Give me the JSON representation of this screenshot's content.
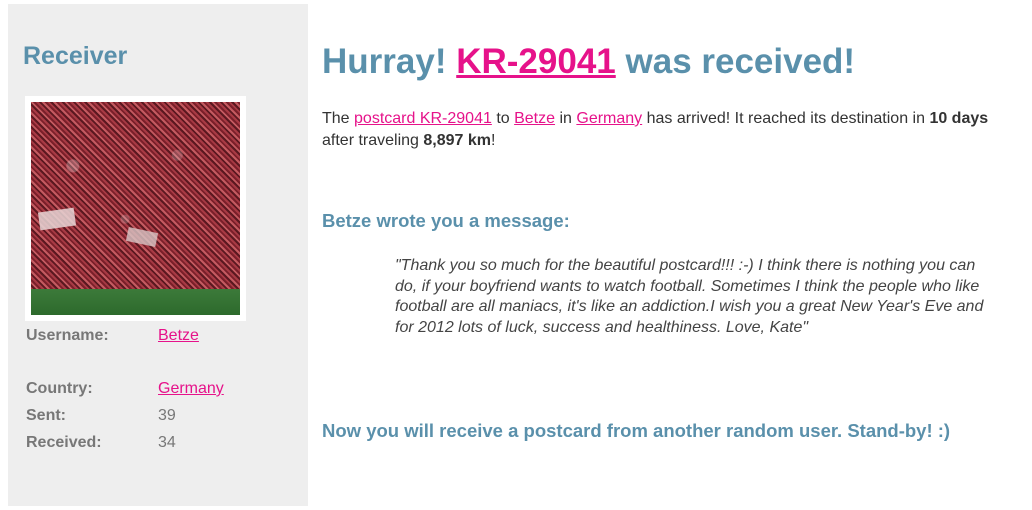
{
  "sidebar": {
    "title": "Receiver",
    "fields": {
      "username_label": "Username:",
      "username_value": "Betze",
      "country_label": "Country:",
      "country_value": "Germany",
      "sent_label": "Sent:",
      "sent_value": "39",
      "received_label": "Received:",
      "received_value": "34"
    }
  },
  "main": {
    "title": {
      "prefix": "Hurray!",
      "code": "KR-29041",
      "suffix": "was received!"
    },
    "arrival": {
      "t1": "The ",
      "postcard_link": "postcard KR-29041",
      "t2": " to ",
      "user_link": "Betze",
      "t3": " in ",
      "country_link": "Germany",
      "t4": " has arrived! It reached its destination in ",
      "days": "10 days",
      "t5": " after traveling ",
      "distance": "8,897 km",
      "t6": "!"
    },
    "message_heading": "Betze wrote you a message:",
    "message": "\"Thank you so much for the beautiful postcard!!! :-) I think there is nothing you can do, if your boyfriend wants to watch football. Sometimes I think the people who like football are all maniacs, it's like an addiction.I wish you a great New Year's Eve and for 2012 lots of luck, success and healthiness. Love, Kate\"",
    "standby": "Now you will receive a postcard from another random user. Stand-by! :)"
  },
  "colors": {
    "heading": "#5a90ab",
    "link": "#e6128a",
    "sidebar_bg": "#eeeeee"
  }
}
